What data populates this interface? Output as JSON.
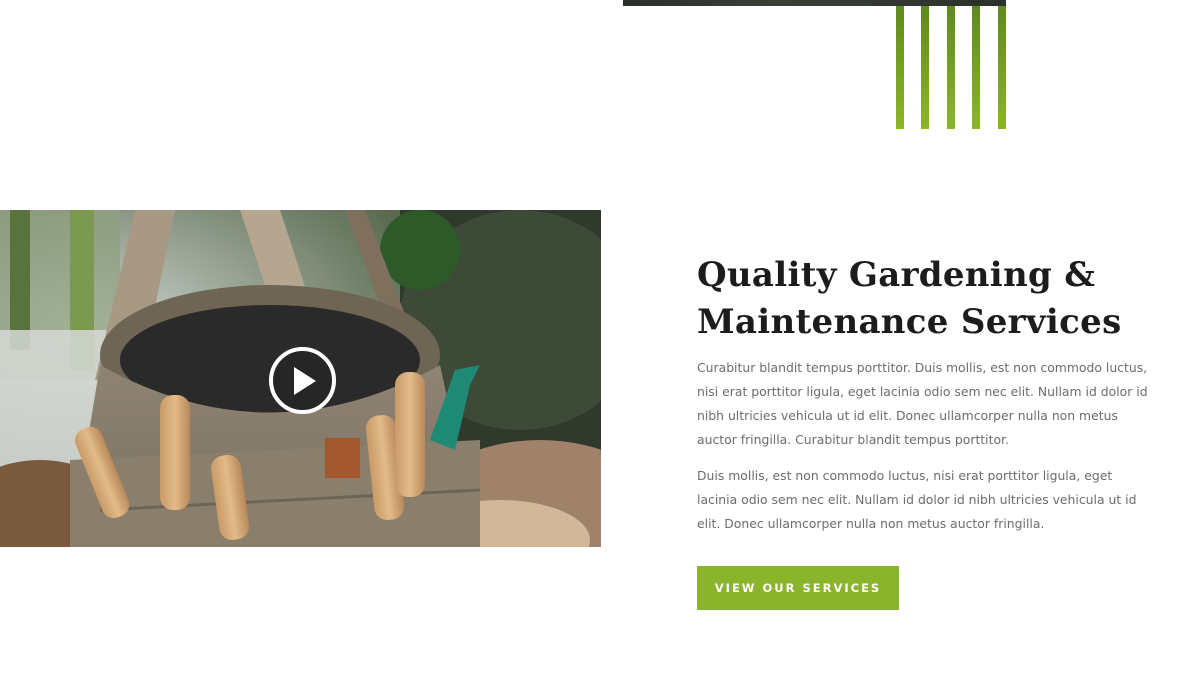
{
  "intro": {
    "heading_lines": [
      "Quality Gardening &",
      "Maintenance Services"
    ],
    "paragraph_1_lines": [
      "Curabitur blandit tempus porttitor. Duis mollis, est non commodo luctus,",
      "nisi erat porttitor ligula, eget lacinia odio sem nec elit. Nullam id dolor id",
      "nibh ultricies vehicula ut id elit. Donec ullamcorper nulla non metus",
      "auctor fringilla. Curabitur blandit tempus porttitor."
    ],
    "paragraph_2_lines": [
      "Duis mollis, est non commodo luctus, nisi erat porttitor ligula, eget",
      "lacinia odio sem nec elit. Nullam id dolor id nibh ultricies vehicula ut id",
      "elit. Donec ullamcorper nulla non metus auctor fringilla."
    ],
    "cta_label": "VIEW OUR SERVICES"
  },
  "video": {
    "play_icon": "play-icon",
    "subject": "garden tool bag with wooden handled tools"
  },
  "colors": {
    "accent_green": "#8ab42a",
    "stripe_green_dark": "#5f8a1d",
    "heading_text": "#1c1c1c",
    "body_text": "#6c6c6c"
  }
}
